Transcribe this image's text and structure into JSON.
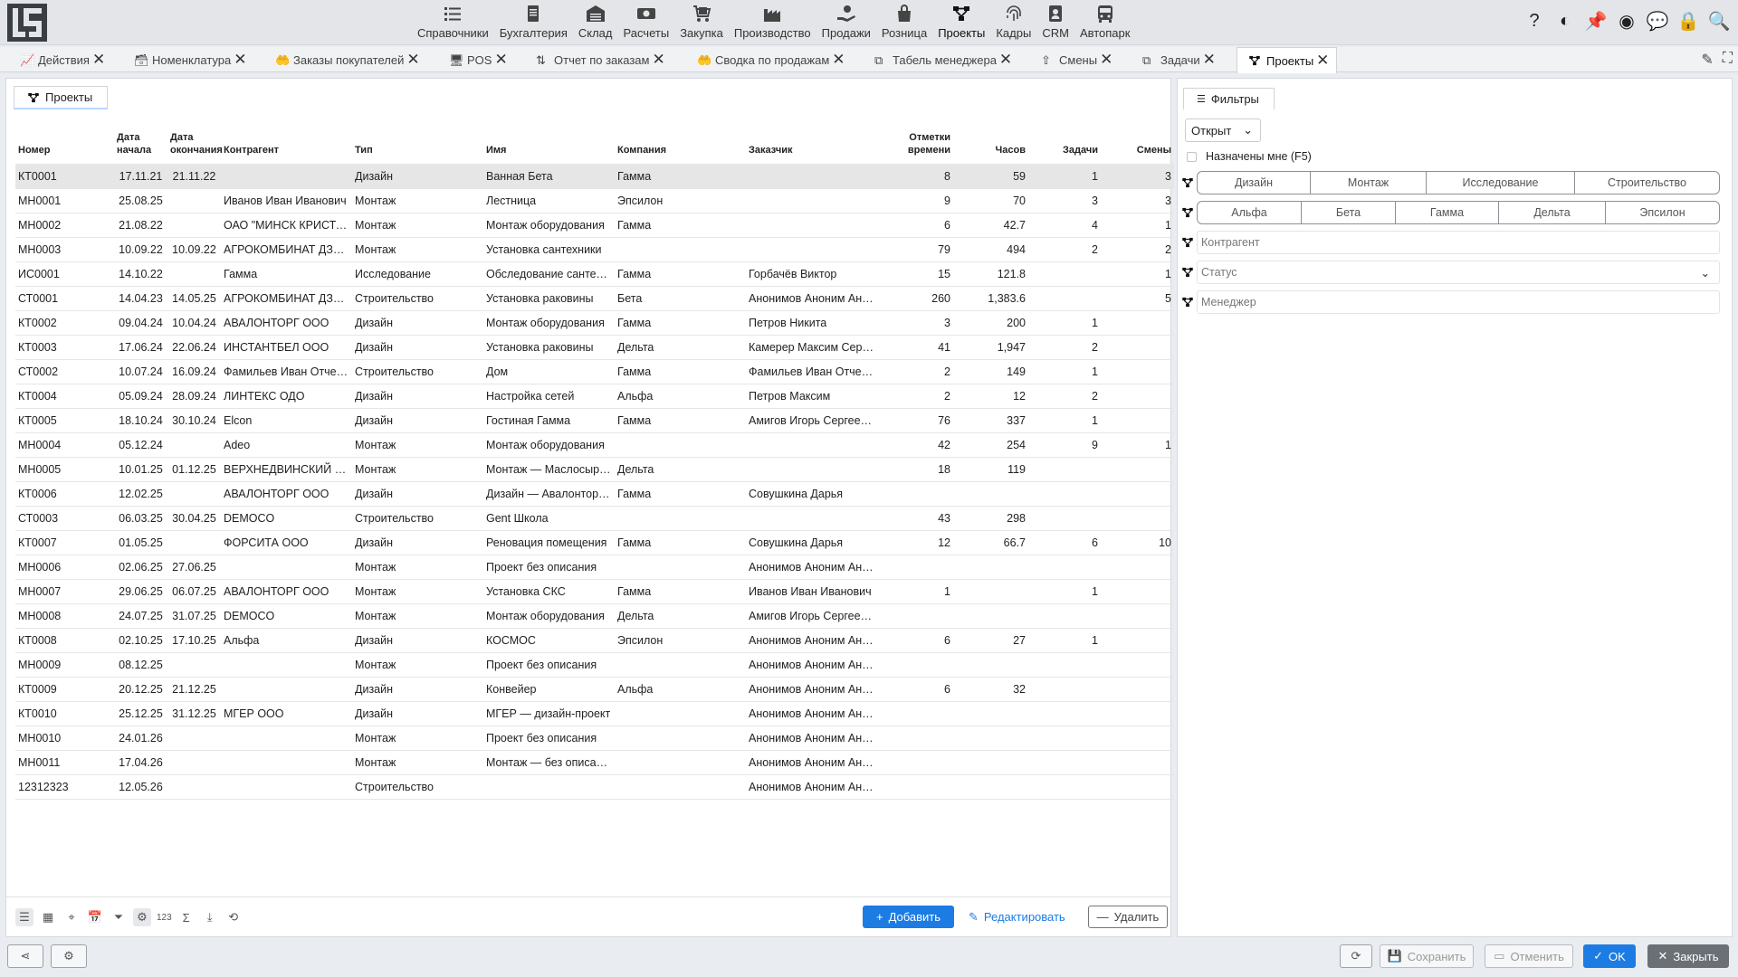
{
  "nav": {
    "items": [
      {
        "label": "Справочники",
        "icon": "list-icon"
      },
      {
        "label": "Бухгалтерия",
        "icon": "document-icon"
      },
      {
        "label": "Склад",
        "icon": "warehouse-icon"
      },
      {
        "label": "Расчеты",
        "icon": "money-icon"
      },
      {
        "label": "Закупка",
        "icon": "cart-icon"
      },
      {
        "label": "Производство",
        "icon": "factory-icon"
      },
      {
        "label": "Продажи",
        "icon": "hand-icon"
      },
      {
        "label": "Розница",
        "icon": "bag-icon"
      },
      {
        "label": "Проекты",
        "icon": "project-icon"
      },
      {
        "label": "Кадры",
        "icon": "fingerprint-icon"
      },
      {
        "label": "CRM",
        "icon": "contact-icon"
      },
      {
        "label": "Автопарк",
        "icon": "bus-icon"
      }
    ]
  },
  "tabs": [
    {
      "label": "Действия"
    },
    {
      "label": "Номенклатура"
    },
    {
      "label": "Заказы покупателей"
    },
    {
      "label": "POS"
    },
    {
      "label": "Отчет по заказам"
    },
    {
      "label": "Сводка по продажам"
    },
    {
      "label": "Табель менеджера"
    },
    {
      "label": "Смены"
    },
    {
      "label": "Задачи"
    },
    {
      "label": "Проекты"
    }
  ],
  "main": {
    "subtab_label": "Проекты",
    "columns": {
      "number": "Номер",
      "start_date": "Дата начала",
      "end_date": "Дата окончания",
      "counterparty": "Контрагент",
      "type": "Тип",
      "name": "Имя",
      "company": "Компания",
      "customer": "Заказчик",
      "time_marks": "Отметки времени",
      "hours": "Часов",
      "tasks": "Задачи",
      "shifts": "Смены"
    },
    "rows": [
      [
        "КТ0001",
        "17.11.21",
        "21.11.22",
        "",
        "Дизайн",
        "Ванная Бета",
        "Гамма",
        "",
        "8",
        "59",
        "1",
        "3"
      ],
      [
        "МН0001",
        "25.08.25",
        "",
        "Иванов Иван Иванович",
        "Монтаж",
        "Лестница",
        "Эпсилон",
        "",
        "9",
        "70",
        "3",
        "3"
      ],
      [
        "МН0002",
        "21.08.22",
        "",
        "ОАО \"МИНСК КРИСТАЛЛ\"",
        "Монтаж",
        "Монтаж оборудования",
        "Гамма",
        "",
        "6",
        "42.7",
        "4",
        "1"
      ],
      [
        "МН0003",
        "10.09.22",
        "10.09.22",
        "АГРОКОМБИНАТ ДЗЕРЖИНСКИЙ",
        "Монтаж",
        "Установка сантехники",
        "",
        "",
        "79",
        "494",
        "2",
        "2"
      ],
      [
        "ИС0001",
        "14.10.22",
        "",
        "Гамма",
        "Исследование",
        "Обследование сантехники",
        "Гамма",
        "Горбачёв Виктор",
        "15",
        "121.8",
        "",
        "1"
      ],
      [
        "СТ0001",
        "14.04.23",
        "14.05.25",
        "АГРОКОМБИНАТ ДЗЕРЖИНСКИЙ",
        "Строительство",
        "Установка раковины",
        "Бета",
        "Анонимов Аноним Анонимович",
        "260",
        "1,383.6",
        "",
        "5"
      ],
      [
        "КТ0002",
        "09.04.24",
        "10.04.24",
        "АВАЛОНТОРГ ООО",
        "Дизайн",
        "Монтаж оборудования",
        "Гамма",
        "Петров Никита",
        "3",
        "200",
        "1",
        ""
      ],
      [
        "КТ0003",
        "17.06.24",
        "22.06.24",
        "ИНСТАНТБЕЛ ООО",
        "Дизайн",
        "Установка раковины",
        "Дельта",
        "Камерер Максим Сергеевич",
        "41",
        "1,947",
        "2",
        ""
      ],
      [
        "СТ0002",
        "10.07.24",
        "16.09.24",
        "Фамильев Иван Отчествович",
        "Строительство",
        "Дом",
        "Гамма",
        "Фамильев Иван Отчествович",
        "2",
        "149",
        "1",
        ""
      ],
      [
        "КТ0004",
        "05.09.24",
        "28.09.24",
        "ЛИНТЕКС ОДО",
        "Дизайн",
        "Настройка сетей",
        "Альфа",
        "Петров Максим",
        "2",
        "12",
        "2",
        ""
      ],
      [
        "КТ0005",
        "18.10.24",
        "30.10.24",
        "Elcon",
        "Дизайн",
        "Гостиная Гамма",
        "Гамма",
        "Амигов Игорь Сергеевич",
        "76",
        "337",
        "1",
        ""
      ],
      [
        "МН0004",
        "05.12.24",
        "",
        "Adeo",
        "Монтаж",
        "Монтаж оборудования",
        "",
        "",
        "42",
        "254",
        "9",
        "1"
      ],
      [
        "МН0005",
        "10.01.25",
        "01.12.25",
        "ВЕРХНЕДВИНСКИЙ МАСЛОСЫРЗАВОД",
        "Монтаж",
        "Монтаж — Маслосырзавод",
        "Дельта",
        "",
        "18",
        "119",
        "",
        ""
      ],
      [
        "КТ0006",
        "12.02.25",
        "",
        "АВАЛОНТОРГ ООО",
        "Дизайн",
        "Дизайн — Авалонторг ООО",
        "Гамма",
        "Совушкина Дарья",
        "",
        "",
        "",
        ""
      ],
      [
        "СТ0003",
        "06.03.25",
        "30.04.25",
        "DEMOCO",
        "Строительство",
        "Gent Школа",
        "",
        "",
        "43",
        "298",
        "",
        ""
      ],
      [
        "КТ0007",
        "01.05.25",
        "",
        "ФОРСИТА ООО",
        "Дизайн",
        "Реновация помещения",
        "Гамма",
        "Совушкина Дарья",
        "12",
        "66.7",
        "6",
        "10"
      ],
      [
        "МН0006",
        "02.06.25",
        "27.06.25",
        "",
        "Монтаж",
        "Проект без описания",
        "",
        "Анонимов Аноним Анонимович",
        "",
        "",
        "",
        ""
      ],
      [
        "МН0007",
        "29.06.25",
        "06.07.25",
        "АВАЛОНТОРГ ООО",
        "Монтаж",
        "Установка СКС",
        "Гамма",
        "Иванов Иван Иванович",
        "1",
        "",
        "1",
        ""
      ],
      [
        "МН0008",
        "24.07.25",
        "31.07.25",
        "DEMOCO",
        "Монтаж",
        "Монтаж оборудования",
        "Дельта",
        "Амигов Игорь Сергеевич",
        "",
        "",
        "",
        ""
      ],
      [
        "КТ0008",
        "02.10.25",
        "17.10.25",
        "Альфа",
        "Дизайн",
        "КОСМОС",
        "Эпсилон",
        "Анонимов Аноним Анонимович",
        "6",
        "27",
        "1",
        ""
      ],
      [
        "МН0009",
        "08.12.25",
        "",
        "",
        "Монтаж",
        "Проект без описания",
        "",
        "Анонимов Аноним Анонимович",
        "",
        "",
        "",
        ""
      ],
      [
        "КТ0009",
        "20.12.25",
        "21.12.25",
        "",
        "Дизайн",
        "Конвейер",
        "Альфа",
        "Анонимов Аноним Анонимович",
        "6",
        "32",
        "",
        ""
      ],
      [
        "КТ0010",
        "25.12.25",
        "31.12.25",
        "МГЕР ООО",
        "Дизайн",
        "МГЕР — дизайн-проект",
        "",
        "Анонимов Аноним Анонимович",
        "",
        "",
        "",
        ""
      ],
      [
        "МН0010",
        "24.01.26",
        "",
        "",
        "Монтаж",
        "Проект без описания",
        "",
        "Анонимов Аноним Анонимович",
        "",
        "",
        "",
        ""
      ],
      [
        "МН0011",
        "17.04.26",
        "",
        "",
        "Монтаж",
        "Монтаж — без описания",
        "",
        "Анонимов Аноним Анонимович",
        "",
        "",
        "",
        ""
      ],
      [
        "12312323",
        "12.05.26",
        "",
        "",
        "Строительство",
        "",
        "",
        "Анонимов Аноним Анонимович",
        "",
        "",
        "",
        ""
      ]
    ],
    "selected_row": 0,
    "footer": {
      "count_label": "123",
      "sum_label": "Σ",
      "add_label": "Добавить",
      "edit_label": "Редактировать",
      "delete_label": "Удалить"
    }
  },
  "filters": {
    "tab_label": "Фильтры",
    "status_select": "Открыт",
    "assigned_to_me": "Назначены мне (F5)",
    "types": [
      "Дизайн",
      "Монтаж",
      "Исследование",
      "Строительство"
    ],
    "companies": [
      "Альфа",
      "Бета",
      "Гамма",
      "Дельта",
      "Эпсилон"
    ],
    "counterparty_placeholder": "Контрагент",
    "status_placeholder": "Статус",
    "manager_placeholder": "Менеджер"
  },
  "bottom": {
    "save_label": "Сохранить",
    "cancel_label": "Отменить",
    "ok_label": "OK",
    "close_label": "Закрыть"
  },
  "colors": {
    "accent": "#1c7ce3",
    "selected_row": "#e6e6e6",
    "close_button": "#6b7076"
  }
}
